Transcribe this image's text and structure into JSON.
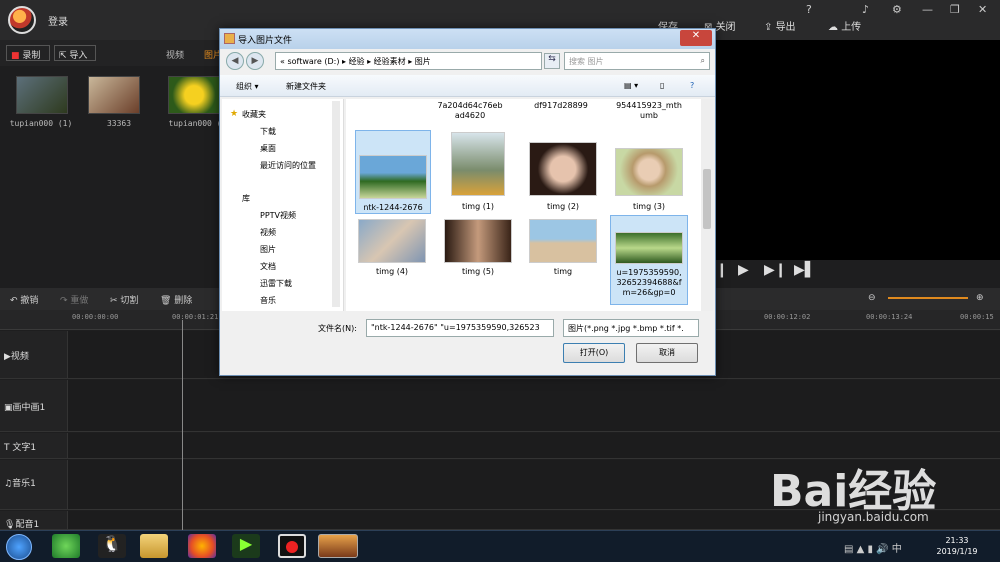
{
  "app": {
    "login": "登录",
    "save": "保存",
    "close": "关闭",
    "export": "导出",
    "upload": "上传",
    "record": "录制",
    "import": "导入",
    "tab_video": "视频",
    "tab_image": "图片"
  },
  "media": [
    {
      "name": "tupian000 (1)",
      "color": "#3b5a2c"
    },
    {
      "name": "33363",
      "color": "#8b5a3c"
    },
    {
      "name": "tupian000 (",
      "color": "#d4b020"
    }
  ],
  "editbar": {
    "undo": "撤销",
    "redo": "重做",
    "cut": "切割",
    "delete": "删除"
  },
  "ruler": [
    "00:00:00:00",
    "00:00:01:21",
    "00:00:12:02",
    "00:00:13:24",
    "00:00:15"
  ],
  "tracks": [
    {
      "label": "视频"
    },
    {
      "label": "画中画1"
    },
    {
      "label": "文字1"
    },
    {
      "label": "音乐1"
    },
    {
      "label": "配音1"
    }
  ],
  "dialog": {
    "title": "导入图片文件",
    "address": [
      "«",
      "software (D:)",
      "经验",
      "经验素材",
      "图片"
    ],
    "search_placeholder": "搜索 图片",
    "organize": "组织 ▾",
    "new_folder": "新建文件夹",
    "nav_items": [
      "收藏夹",
      "下载",
      "桌面",
      "最近访问的位置",
      "库",
      "PPTV视频",
      "视频",
      "图片",
      "文档",
      "迅雷下载",
      "音乐"
    ],
    "top_captions": [
      "7a204d64c76eb\nad4620",
      "df917d28899",
      "954415923_mth\numb"
    ],
    "files": [
      {
        "name": "ntk-1244-2676",
        "selected": true
      },
      {
        "name": "timg (1)",
        "selected": false
      },
      {
        "name": "timg (2)",
        "selected": false
      },
      {
        "name": "timg (3)",
        "selected": false
      },
      {
        "name": "timg (4)",
        "selected": false
      },
      {
        "name": "timg (5)",
        "selected": false
      },
      {
        "name": "timg",
        "selected": false
      },
      {
        "name": "u=1975359590,\n32652394688&f\nm=26&gp=0",
        "selected": true
      }
    ],
    "filename_label": "文件名(N):",
    "filename_value": "\"ntk-1244-2676\" \"u=1975359590,326523",
    "filetype": "图片(*.png *.jpg *.bmp *.tif *.",
    "open": "打开(O)",
    "cancel": "取消"
  },
  "taskbar": {
    "time": "21:33",
    "date": "2019/1/19"
  },
  "watermark": {
    "brand": "Bai经验",
    "url": "jingyan.baidu.com"
  }
}
